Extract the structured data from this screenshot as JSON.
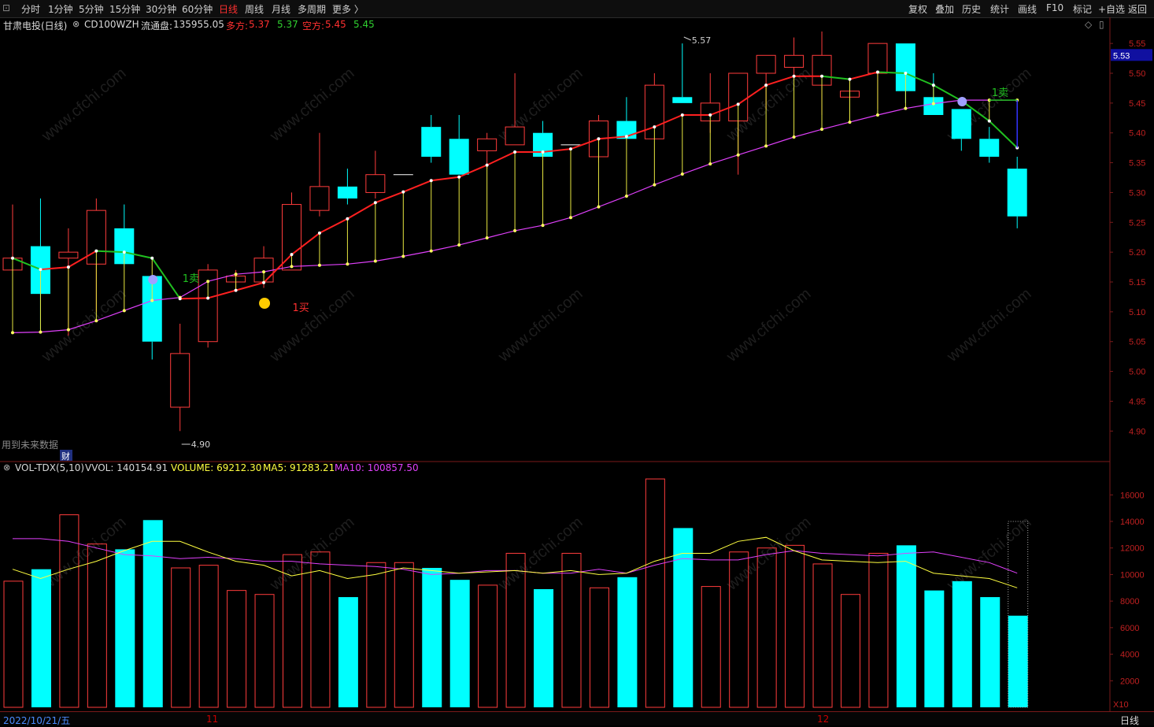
{
  "toolbar": {
    "periods": [
      "分时",
      "1分钟",
      "5分钟",
      "15分钟",
      "30分钟",
      "60分钟",
      "日线",
      "周线",
      "月线",
      "多周期",
      "更多 〉"
    ],
    "active_period": "日线",
    "actions": [
      "复权",
      "叠加",
      "历史",
      "统计",
      "画线",
      "F10",
      "标记",
      "+自选",
      "返回"
    ]
  },
  "info": {
    "stock": "甘肃电投(日线)",
    "indicator": "CD100WZH",
    "float_label": "流通盘:",
    "float_value": "135955.05",
    "long_label": "多方:",
    "long_v1": "5.37",
    "long_v2": "5.37",
    "short_label": "空方:",
    "short_v1": "5.45",
    "short_v2": "5.45"
  },
  "price_panel": {
    "current_price": "5.53",
    "high_marker": "5.57",
    "low_marker": "4.90",
    "buy_label": "1买",
    "sell_label": "1卖",
    "warning": "用到未来数据",
    "fin_marker": "财",
    "axis_ticks": [
      "5.55",
      "5.50",
      "5.45",
      "5.40",
      "5.35",
      "5.30",
      "5.25",
      "5.20",
      "5.15",
      "5.10",
      "5.05",
      "5.00",
      "4.95",
      "4.90"
    ]
  },
  "volume_panel": {
    "indicator": "VOL-TDX(5,10)",
    "vvol": "VVOL: 140154.91",
    "volume": "VOLUME: 69212.30",
    "ma5": "MA5: 91283.21",
    "ma10": "MA10: 100857.50",
    "multiplier": "X10",
    "axis_ticks": [
      "16000",
      "14000",
      "12000",
      "10000",
      "8000",
      "6000",
      "4000",
      "2000"
    ]
  },
  "bottom": {
    "date": "2022/10/21/五",
    "month_nov": "11",
    "month_dec": "12",
    "period": "日线"
  },
  "watermark": "www.cfchi.com",
  "colors": {
    "up": "#ff3c3c",
    "down": "#00ffff",
    "ma_short": "#ffff40",
    "ma_long": "#e040fb",
    "bull_line": "#ff2020",
    "bear_line": "#20c020"
  },
  "chart_data": {
    "type": "candlestick",
    "ylim": [
      4.87,
      5.57
    ],
    "vol_ylim": [
      0,
      17500
    ],
    "candles": [
      {
        "o": 5.17,
        "h": 5.28,
        "l": 5.13,
        "c": 5.19,
        "v": 9500
      },
      {
        "o": 5.21,
        "h": 5.29,
        "l": 5.07,
        "c": 5.13,
        "v": 10400
      },
      {
        "o": 5.19,
        "h": 5.24,
        "l": 5.06,
        "c": 5.2,
        "v": 14500
      },
      {
        "o": 5.18,
        "h": 5.29,
        "l": 5.1,
        "c": 5.27,
        "v": 12300
      },
      {
        "o": 5.24,
        "h": 5.28,
        "l": 5.18,
        "c": 5.18,
        "v": 11900
      },
      {
        "o": 5.16,
        "h": 5.16,
        "l": 5.02,
        "c": 5.05,
        "v": 14100
      },
      {
        "o": 4.94,
        "h": 5.08,
        "l": 4.9,
        "c": 5.03,
        "v": 10500
      },
      {
        "o": 5.05,
        "h": 5.18,
        "l": 5.04,
        "c": 5.17,
        "v": 10700
      },
      {
        "o": 5.15,
        "h": 5.17,
        "l": 5.14,
        "c": 5.16,
        "v": 8800
      },
      {
        "o": 5.15,
        "h": 5.21,
        "l": 5.14,
        "c": 5.19,
        "v": 8500
      },
      {
        "o": 5.17,
        "h": 5.3,
        "l": 5.17,
        "c": 5.28,
        "v": 11500
      },
      {
        "o": 5.27,
        "h": 5.4,
        "l": 5.26,
        "c": 5.31,
        "v": 11700
      },
      {
        "o": 5.31,
        "h": 5.34,
        "l": 5.28,
        "c": 5.29,
        "v": 8300
      },
      {
        "o": 5.3,
        "h": 5.37,
        "l": 5.29,
        "c": 5.33,
        "v": 10900
      },
      {
        "o": 5.33,
        "h": 5.33,
        "l": 5.33,
        "c": 5.33,
        "v": 10900
      },
      {
        "o": 5.41,
        "h": 5.43,
        "l": 5.35,
        "c": 5.36,
        "v": 10500
      },
      {
        "o": 5.39,
        "h": 5.43,
        "l": 5.33,
        "c": 5.33,
        "v": 9600
      },
      {
        "o": 5.37,
        "h": 5.4,
        "l": 5.34,
        "c": 5.39,
        "v": 9200
      },
      {
        "o": 5.38,
        "h": 5.5,
        "l": 5.38,
        "c": 5.41,
        "v": 11600
      },
      {
        "o": 5.4,
        "h": 5.42,
        "l": 5.36,
        "c": 5.36,
        "v": 8900
      },
      {
        "o": 5.38,
        "h": 5.38,
        "l": 5.38,
        "c": 5.38,
        "v": 11600
      },
      {
        "o": 5.36,
        "h": 5.43,
        "l": 5.35,
        "c": 5.42,
        "v": 9000
      },
      {
        "o": 5.42,
        "h": 5.46,
        "l": 5.39,
        "c": 5.39,
        "v": 9800
      },
      {
        "o": 5.39,
        "h": 5.5,
        "l": 5.39,
        "c": 5.48,
        "v": 17200
      },
      {
        "o": 5.46,
        "h": 5.55,
        "l": 5.45,
        "c": 5.45,
        "v": 13500
      },
      {
        "o": 5.42,
        "h": 5.5,
        "l": 5.4,
        "c": 5.45,
        "v": 9100
      },
      {
        "o": 5.42,
        "h": 5.5,
        "l": 5.33,
        "c": 5.5,
        "v": 11700
      },
      {
        "o": 5.5,
        "h": 5.52,
        "l": 5.44,
        "c": 5.53,
        "v": 12000
      },
      {
        "o": 5.51,
        "h": 5.56,
        "l": 5.49,
        "c": 5.53,
        "v": 12200
      },
      {
        "o": 5.48,
        "h": 5.57,
        "l": 5.43,
        "c": 5.53,
        "v": 10800
      },
      {
        "o": 5.46,
        "h": 5.47,
        "l": 5.45,
        "c": 5.47,
        "v": 8500
      },
      {
        "o": 5.5,
        "h": 5.55,
        "l": 5.44,
        "c": 5.55,
        "v": 11600
      },
      {
        "o": 5.55,
        "h": 5.55,
        "l": 5.45,
        "c": 5.47,
        "v": 12200
      },
      {
        "o": 5.46,
        "h": 5.5,
        "l": 5.43,
        "c": 5.43,
        "v": 8800
      },
      {
        "o": 5.44,
        "h": 5.44,
        "l": 5.37,
        "c": 5.39,
        "v": 9500
      },
      {
        "o": 5.39,
        "h": 5.41,
        "l": 5.35,
        "c": 5.36,
        "v": 8300
      },
      {
        "o": 5.34,
        "h": 5.36,
        "l": 5.24,
        "c": 5.26,
        "v": 6900
      }
    ],
    "ma_long": [
      5.065,
      5.066,
      5.07,
      5.085,
      5.102,
      5.119,
      5.124,
      5.151,
      5.163,
      5.167,
      5.176,
      5.178,
      5.18,
      5.185,
      5.193,
      5.202,
      5.212,
      5.224,
      5.236,
      5.245,
      5.258,
      5.276,
      5.294,
      5.313,
      5.331,
      5.348,
      5.363,
      5.378,
      5.393,
      5.406,
      5.418,
      5.43,
      5.441,
      5.449,
      5.455,
      5.455,
      5.455
    ],
    "ma_short": [
      5.19,
      5.171,
      5.175,
      5.202,
      5.2,
      5.19,
      5.122,
      5.123,
      5.136,
      5.149,
      5.196,
      5.232,
      5.256,
      5.283,
      5.301,
      5.32,
      5.326,
      5.346,
      5.368,
      5.368,
      5.373,
      5.39,
      5.394,
      5.41,
      5.43,
      5.43,
      5.448,
      5.48,
      5.495,
      5.495,
      5.49,
      5.502,
      5.5,
      5.48,
      5.454,
      5.42,
      5.375
    ],
    "vol_ma5": [
      10400,
      9700,
      10400,
      11000,
      11800,
      12500,
      12500,
      11700,
      11000,
      10700,
      9900,
      10300,
      9700,
      10000,
      10500,
      10300,
      10100,
      10200,
      10300,
      10100,
      10300,
      10000,
      10100,
      11000,
      11600,
      11600,
      12500,
      12800,
      11800,
      11100,
      11000,
      10900,
      11000,
      10100,
      9900,
      9700,
      9000
    ],
    "vol_ma10": [
      12700,
      12700,
      12500,
      12000,
      11500,
      11400,
      11200,
      11300,
      11200,
      11000,
      11000,
      10800,
      10700,
      10600,
      10400,
      10000,
      10100,
      10300,
      10300,
      10100,
      10100,
      10400,
      10100,
      10700,
      11200,
      11100,
      11100,
      11500,
      11800,
      11600,
      11500,
      11400,
      11600,
      11700,
      11300,
      10900,
      10100
    ]
  }
}
